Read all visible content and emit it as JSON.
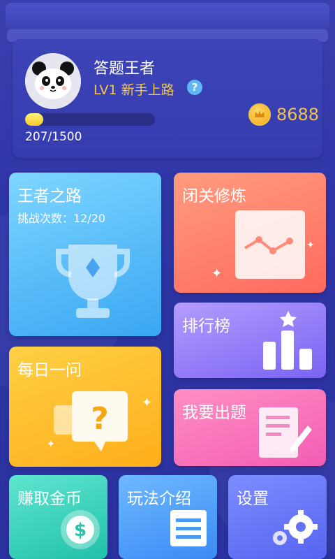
{
  "profile": {
    "name": "答题王者",
    "level": "LV1  新手上路",
    "help_icon": "?",
    "xp_text": "207/1500",
    "xp_progress": 0.138,
    "coins": "8688"
  },
  "cards": {
    "road": {
      "title": "王者之路",
      "subtitle": "挑战次数：12/20"
    },
    "train": {
      "title": "闭关修炼"
    },
    "rank": {
      "title": "排行榜"
    },
    "daily": {
      "title": "每日一问"
    },
    "ask": {
      "title": "我要出题"
    },
    "earn": {
      "title": "赚取金币"
    },
    "rules": {
      "title": "玩法介绍"
    },
    "settings": {
      "title": "设置"
    }
  },
  "icons": {
    "avatar": "panda-avatar",
    "coin": "crown-coin-icon",
    "trophy": "trophy-icon",
    "chart": "line-chart-icon",
    "podium": "bar-podium-icon",
    "question": "question-bubble-icon",
    "edit": "edit-document-icon",
    "dollar": "dollar-coin-icon",
    "list": "document-list-icon",
    "gear": "gear-icon"
  },
  "colors": {
    "background": "#2e35a6",
    "gold": "#f4c443",
    "level": "#f3c94a"
  }
}
